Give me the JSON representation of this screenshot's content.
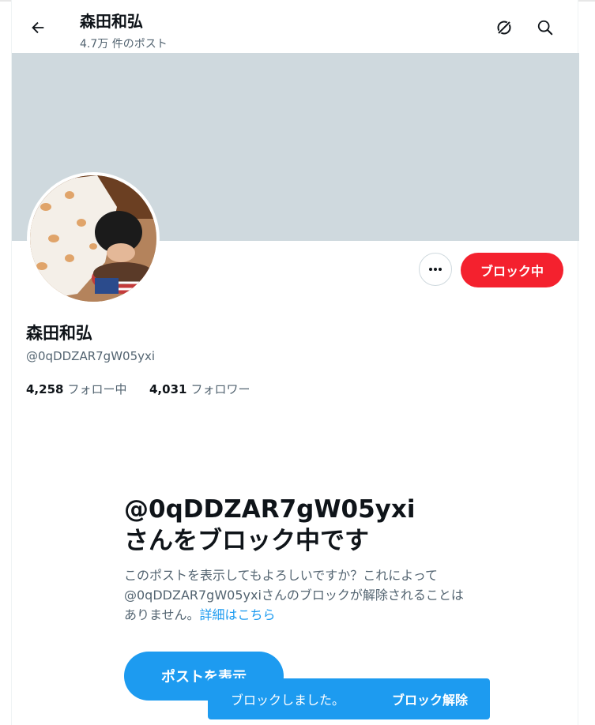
{
  "header": {
    "title": "森田和弘",
    "post_count": "4.7万 件のポスト",
    "back_icon": "arrow-left-icon",
    "grok_icon": "grok-icon",
    "search_icon": "search-icon"
  },
  "profile": {
    "name": "森田和弘",
    "handle": "@0qDDZAR7gW05yxi",
    "blocking_label": "ブロック中",
    "more_icon": "more-dots-icon",
    "following_count": "4,258",
    "following_label": "フォロー中",
    "followers_count": "4,031",
    "followers_label": "フォロワー"
  },
  "blocked_notice": {
    "title_line1": "@0qDDZAR7gW05yxi",
    "title_line2": "さんをブロック中です",
    "description": "このポストを表示してもよろしいですか？これによって@0qDDZAR7gW05yxiさんのブロックが解除されることはありません。",
    "link": "詳細はこちら",
    "view_button": "ポストを表示"
  },
  "toast": {
    "message": "ブロックしました。",
    "undo": "ブロック解除"
  },
  "colors": {
    "accent": "#1d9bf0",
    "block_red": "#f4212e",
    "banner": "#cfd9de"
  }
}
